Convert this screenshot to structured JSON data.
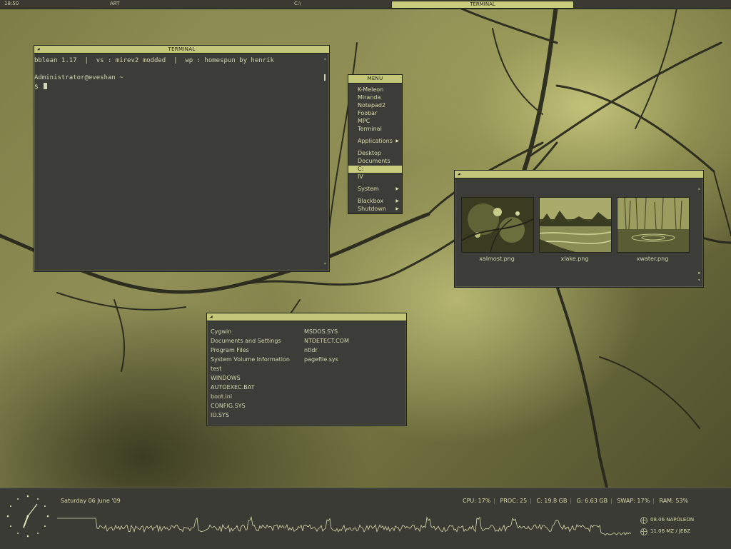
{
  "topbar": {
    "clock": "18:50",
    "workspace": "ART",
    "path": "C:\\",
    "active_task": "TERMINAL"
  },
  "terminal": {
    "title": "TERMINAL",
    "lines": [
      "bblean 1.17  |  vs : mirev2 modded  |  wp : homespun by henrik",
      "",
      "Administrator@eveshan ~",
      "$ "
    ]
  },
  "menu": {
    "title": "MENU",
    "items": [
      {
        "label": "K-Meleon",
        "submenu": false,
        "active": false
      },
      {
        "label": "Miranda",
        "submenu": false,
        "active": false
      },
      {
        "label": "Notepad2",
        "submenu": false,
        "active": false
      },
      {
        "label": "Foobar",
        "submenu": false,
        "active": false
      },
      {
        "label": "MPC",
        "submenu": false,
        "active": false
      },
      {
        "label": "Terminal",
        "submenu": false,
        "active": false
      },
      {
        "label": "Applications",
        "submenu": true,
        "active": false
      },
      {
        "label": "Desktop",
        "submenu": false,
        "active": false
      },
      {
        "label": "Documents",
        "submenu": false,
        "active": false
      },
      {
        "label": "C:",
        "submenu": false,
        "active": true
      },
      {
        "label": "IV",
        "submenu": false,
        "active": false
      },
      {
        "label": "System",
        "submenu": true,
        "active": false
      },
      {
        "label": "Blackbox",
        "submenu": true,
        "active": false
      },
      {
        "label": "Shutdown",
        "submenu": true,
        "active": false
      }
    ]
  },
  "image_viewer": {
    "files": [
      {
        "name": "xalmost.png"
      },
      {
        "name": "xlake.png"
      },
      {
        "name": "xwater.png"
      }
    ]
  },
  "explorer": {
    "col1": [
      "Cygwin",
      "Documents and Settings",
      "Program Files",
      "System Volume Information",
      "test",
      "WINDOWS",
      "AUTOEXEC.BAT",
      "boot.ini",
      "CONFIG.SYS",
      "IO.SYS"
    ],
    "col2": [
      "MSDOS.SYS",
      "NTDETECT.COM",
      "ntldr",
      "pagefile.sys"
    ]
  },
  "panel": {
    "date": "Saturday 06 June '09",
    "stats": [
      "CPU: 17%",
      "PROC: 25",
      "C: 19.8 GB",
      "G: 6.63 GB",
      "SWAP: 17%",
      "RAM: 53%"
    ],
    "media": [
      "08.06 NAPOLEON",
      "11.06 MZ / JEBZ"
    ]
  },
  "colors": {
    "accent": "#c8cc7c",
    "window_bg": "#3c3d38",
    "text": "#d8dba8"
  }
}
